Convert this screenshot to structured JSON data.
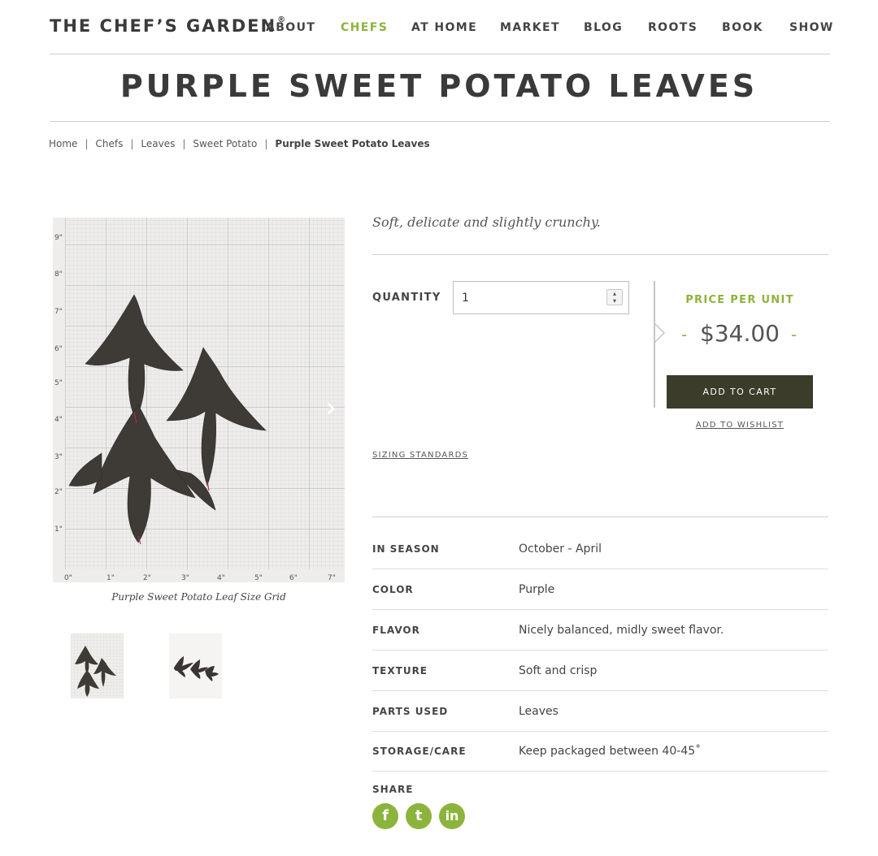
{
  "header": {
    "logo": "THE CHEF’S GARDEN",
    "logo_mark": "®",
    "nav": [
      {
        "label": "ABOUT"
      },
      {
        "label": "CHEFS"
      },
      {
        "label": "AT HOME"
      },
      {
        "label": "MARKET"
      },
      {
        "label": "BLOG"
      },
      {
        "label": "ROOTS"
      },
      {
        "label": "BOOK"
      },
      {
        "label": "SHOW"
      }
    ],
    "active_nav": "CHEFS"
  },
  "page": {
    "title": "PURPLE SWEET POTATO LEAVES"
  },
  "breadcrumb": {
    "items": [
      "Home",
      "Chefs",
      "Leaves",
      "Sweet Potato"
    ],
    "separator": "|",
    "current": "Purple Sweet Potato Leaves"
  },
  "gallery": {
    "caption": "Purple Sweet Potato Leaf Size Grid",
    "y_ticks": [
      "9\"",
      "8\"",
      "7\"",
      "6\"",
      "5\"",
      "4\"",
      "3\"",
      "2\"",
      "1\""
    ],
    "x_ticks": [
      "0\"",
      "1\"",
      "2\"",
      "3\"",
      "4\"",
      "5\"",
      "6\"",
      "7\""
    ],
    "next_icon": "›"
  },
  "product": {
    "tagline": "Soft, delicate and slightly crunchy.",
    "quantity_label": "QUANTITY",
    "quantity_value": "1",
    "price_label": "PRICE PER UNIT",
    "price": "$34.00",
    "price_dash": "-",
    "add_to_cart": "ADD TO CART",
    "add_to_wishlist": "ADD TO WISHLIST",
    "sizing_link": "SIZING STANDARDS"
  },
  "specs": [
    {
      "label": "IN SEASON",
      "value": "October - April"
    },
    {
      "label": "COLOR",
      "value": "Purple"
    },
    {
      "label": "FLAVOR",
      "value": "Nicely balanced, midly sweet flavor."
    },
    {
      "label": "TEXTURE",
      "value": "Soft and crisp"
    },
    {
      "label": "PARTS USED",
      "value": "Leaves"
    },
    {
      "label": "STORAGE/CARE",
      "value": "Keep packaged between 40-45˚"
    }
  ],
  "share": {
    "label": "SHARE",
    "icons": [
      {
        "name": "facebook-icon",
        "glyph": "f"
      },
      {
        "name": "twitter-icon",
        "glyph": "t"
      },
      {
        "name": "linkedin-icon",
        "glyph": "in"
      }
    ]
  },
  "colors": {
    "accent": "#8cb43c",
    "button": "#3b3d2a",
    "text": "#444444"
  }
}
